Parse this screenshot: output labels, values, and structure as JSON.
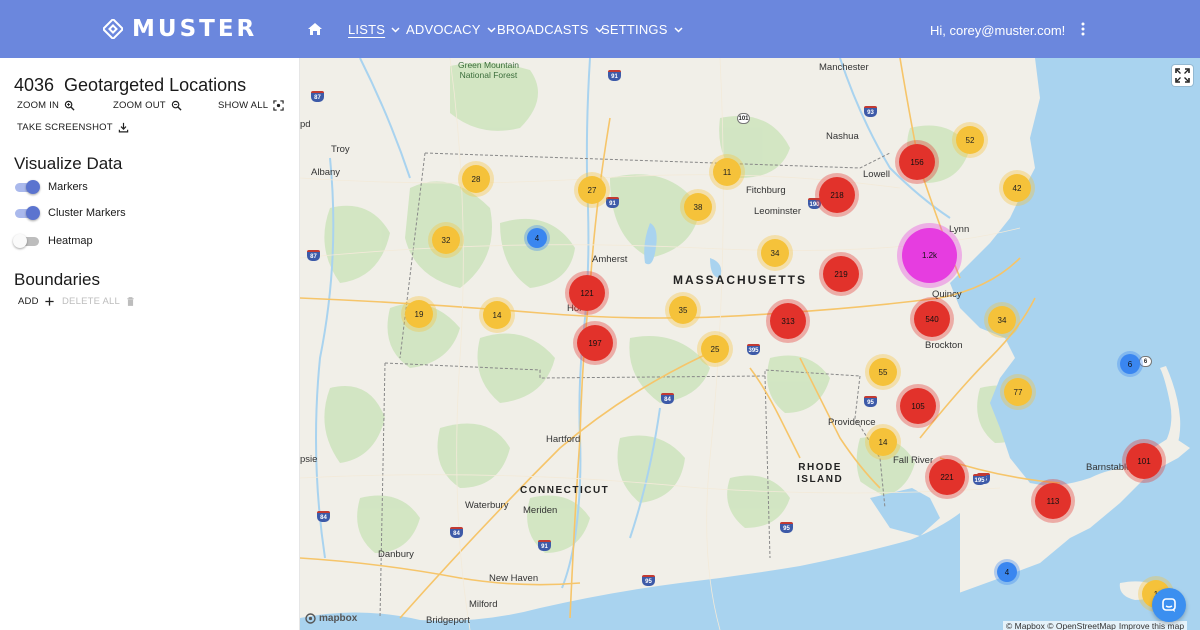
{
  "header": {
    "brand": "MUSTER",
    "nav": [
      {
        "label": "LISTS",
        "active": true
      },
      {
        "label": "ADVOCACY",
        "active": false
      },
      {
        "label": "BROADCASTS",
        "active": false
      },
      {
        "label": "SETTINGS",
        "active": false
      }
    ],
    "greeting": "Hi,  corey@muster.com!",
    "home_icon": "home-icon",
    "menu_icon": "more-vertical-icon",
    "bar_color": "#6b87dd"
  },
  "sidebar": {
    "location_count": "4036",
    "location_title": "Geotargeted Locations",
    "zoom_in": "ZOOM IN",
    "zoom_out": "ZOOM OUT",
    "show_all": "SHOW ALL",
    "take_screenshot": "TAKE SCREENSHOT",
    "visualize_title": "Visualize Data",
    "toggles": [
      {
        "label": "Markers",
        "on": true
      },
      {
        "label": "Cluster Markers",
        "on": true
      },
      {
        "label": "Heatmap",
        "on": false
      }
    ],
    "boundaries_title": "Boundaries",
    "add": "ADD",
    "delete_all": "DELETE ALL"
  },
  "map": {
    "places": {
      "manchester": "Manchester",
      "nashua": "Nashua",
      "lowell": "Lowell",
      "lynn": "Lynn",
      "fitchburg": "Fitchburg",
      "leominster": "Leominster",
      "amherst": "Amherst",
      "quincy": "Quincy",
      "brockton": "Brockton",
      "providence": "Providence",
      "fall_river": "Fall River",
      "barnstable": "Barnstable",
      "hartford": "Hartford",
      "waterbury": "Waterbury",
      "meriden": "Meriden",
      "danbury": "Danbury",
      "new_haven": "New Haven",
      "milford": "Milford",
      "bridgeport": "Bridgeport",
      "troy": "Troy",
      "albany": "Albany",
      "holyoke": "Hol",
      "edge_psie": "psie",
      "edge_pd": "pd"
    },
    "forest": [
      "Green Mountain",
      "National Forest"
    ],
    "states": {
      "massachusetts": "MASSACHUSETTS",
      "connecticut": "CONNECTICUT",
      "rhode_island": [
        "RHODE",
        "ISLAND"
      ]
    },
    "shields": [
      "91",
      "87",
      "101",
      "93",
      "91",
      "190",
      "87",
      "395",
      "84",
      "95",
      "95",
      "195",
      "6",
      "84",
      "91",
      "84",
      "95",
      "95"
    ],
    "clusters": [
      {
        "label": "28",
        "color": "yellow"
      },
      {
        "label": "27",
        "color": "yellow"
      },
      {
        "label": "11",
        "color": "yellow"
      },
      {
        "label": "218",
        "color": "red"
      },
      {
        "label": "156",
        "color": "red"
      },
      {
        "label": "52",
        "color": "yellow"
      },
      {
        "label": "42",
        "color": "yellow"
      },
      {
        "label": "38",
        "color": "yellow"
      },
      {
        "label": "32",
        "color": "yellow"
      },
      {
        "label": "4",
        "color": "blue"
      },
      {
        "label": "34",
        "color": "yellow"
      },
      {
        "label": "219",
        "color": "red"
      },
      {
        "label": "1.2k",
        "color": "magenta"
      },
      {
        "label": "121",
        "color": "red"
      },
      {
        "label": "19",
        "color": "yellow"
      },
      {
        "label": "14",
        "color": "yellow"
      },
      {
        "label": "35",
        "color": "yellow"
      },
      {
        "label": "313",
        "color": "red"
      },
      {
        "label": "540",
        "color": "red"
      },
      {
        "label": "34",
        "color": "yellow"
      },
      {
        "label": "197",
        "color": "red"
      },
      {
        "label": "25",
        "color": "yellow"
      },
      {
        "label": "55",
        "color": "yellow"
      },
      {
        "label": "6",
        "color": "blue"
      },
      {
        "label": "77",
        "color": "yellow"
      },
      {
        "label": "105",
        "color": "red"
      },
      {
        "label": "14",
        "color": "yellow"
      },
      {
        "label": "221",
        "color": "red"
      },
      {
        "label": "101",
        "color": "red"
      },
      {
        "label": "113",
        "color": "red"
      },
      {
        "label": "4",
        "color": "blue"
      },
      {
        "label": "1",
        "color": "yellow"
      }
    ],
    "mapbox_logo": "mapbox",
    "attribution": "© Mapbox © OpenStreetMap",
    "improve_link": "Improve this map",
    "fullscreen_icon": "fullscreen-icon",
    "chat_icon": "chat-icon"
  }
}
